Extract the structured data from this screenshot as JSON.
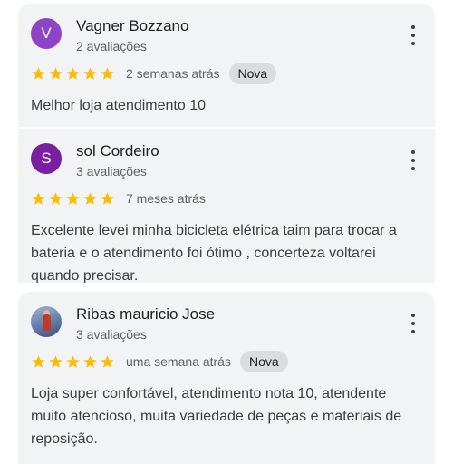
{
  "reviews": [
    {
      "avatar_letter": "V",
      "avatar_color": "#8e44c9",
      "name": "Vagner Bozzano",
      "review_count": "2 avaliações",
      "rating": 5,
      "date": "2 semanas atrás",
      "badge": "Nova",
      "text": "Melhor loja atendimento 10"
    },
    {
      "avatar_letter": "S",
      "avatar_color": "#7b1fa2",
      "name": "sol Cordeiro",
      "review_count": "3 avaliações",
      "rating": 5,
      "date": "7 meses atrás",
      "badge": "",
      "text": "Excelente levei minha bicicleta elétrica taim para trocar a bateria e o atendimento foi ótimo , concerteza voltarei quando precisar."
    },
    {
      "avatar_letter": "",
      "avatar_color": "#6d87b3",
      "name": "Ribas mauricio Jose",
      "review_count": "3 avaliações",
      "rating": 5,
      "date": "uma semana atrás",
      "badge": "Nova",
      "text": "Loja super confortável, atendimento nota 10, atendente muito atencioso, muita variedade de peças e materiais de reposição."
    }
  ],
  "colors": {
    "star": "#fbbc04",
    "card_bg": "#f1f3f4"
  },
  "icons": {
    "menu": "more-vert-icon",
    "star": "star-icon"
  }
}
